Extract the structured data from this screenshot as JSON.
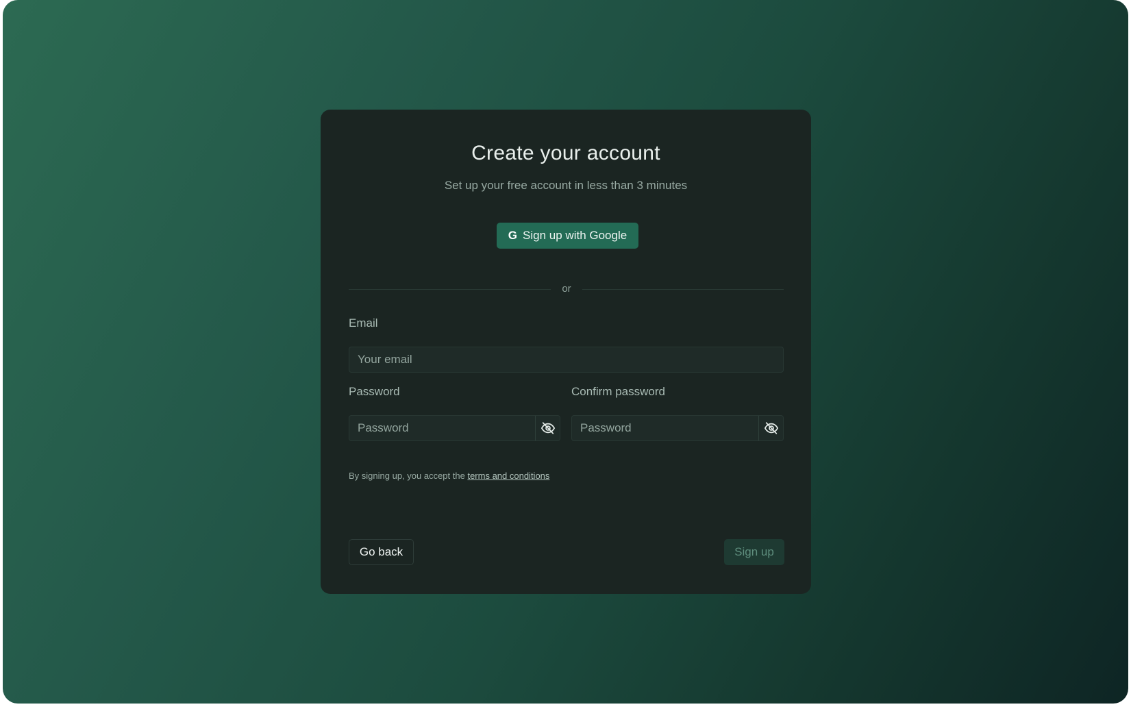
{
  "header": {
    "title": "Create your account",
    "subtitle": "Set up your free account in less than 3 minutes"
  },
  "oauth": {
    "google_label": "Sign up with Google",
    "google_icon": "google-g-icon"
  },
  "divider": {
    "text": "or"
  },
  "form": {
    "email_label": "Email",
    "email_placeholder": "Your email",
    "email_value": "",
    "password_label": "Password",
    "password_placeholder": "Password",
    "password_value": "",
    "confirm_label": "Confirm password",
    "confirm_placeholder": "Password",
    "confirm_value": "",
    "visibility_icon": "eye-off-icon"
  },
  "terms": {
    "prefix": "By signing up, you accept the ",
    "link_text": "terms and conditions"
  },
  "actions": {
    "back_label": "Go back",
    "submit_label": "Sign up"
  },
  "colors": {
    "accent": "#236b55",
    "card_background": "#1b2522",
    "submit_disabled_bg": "#1e3a32",
    "submit_disabled_text": "#5f8e7e"
  }
}
